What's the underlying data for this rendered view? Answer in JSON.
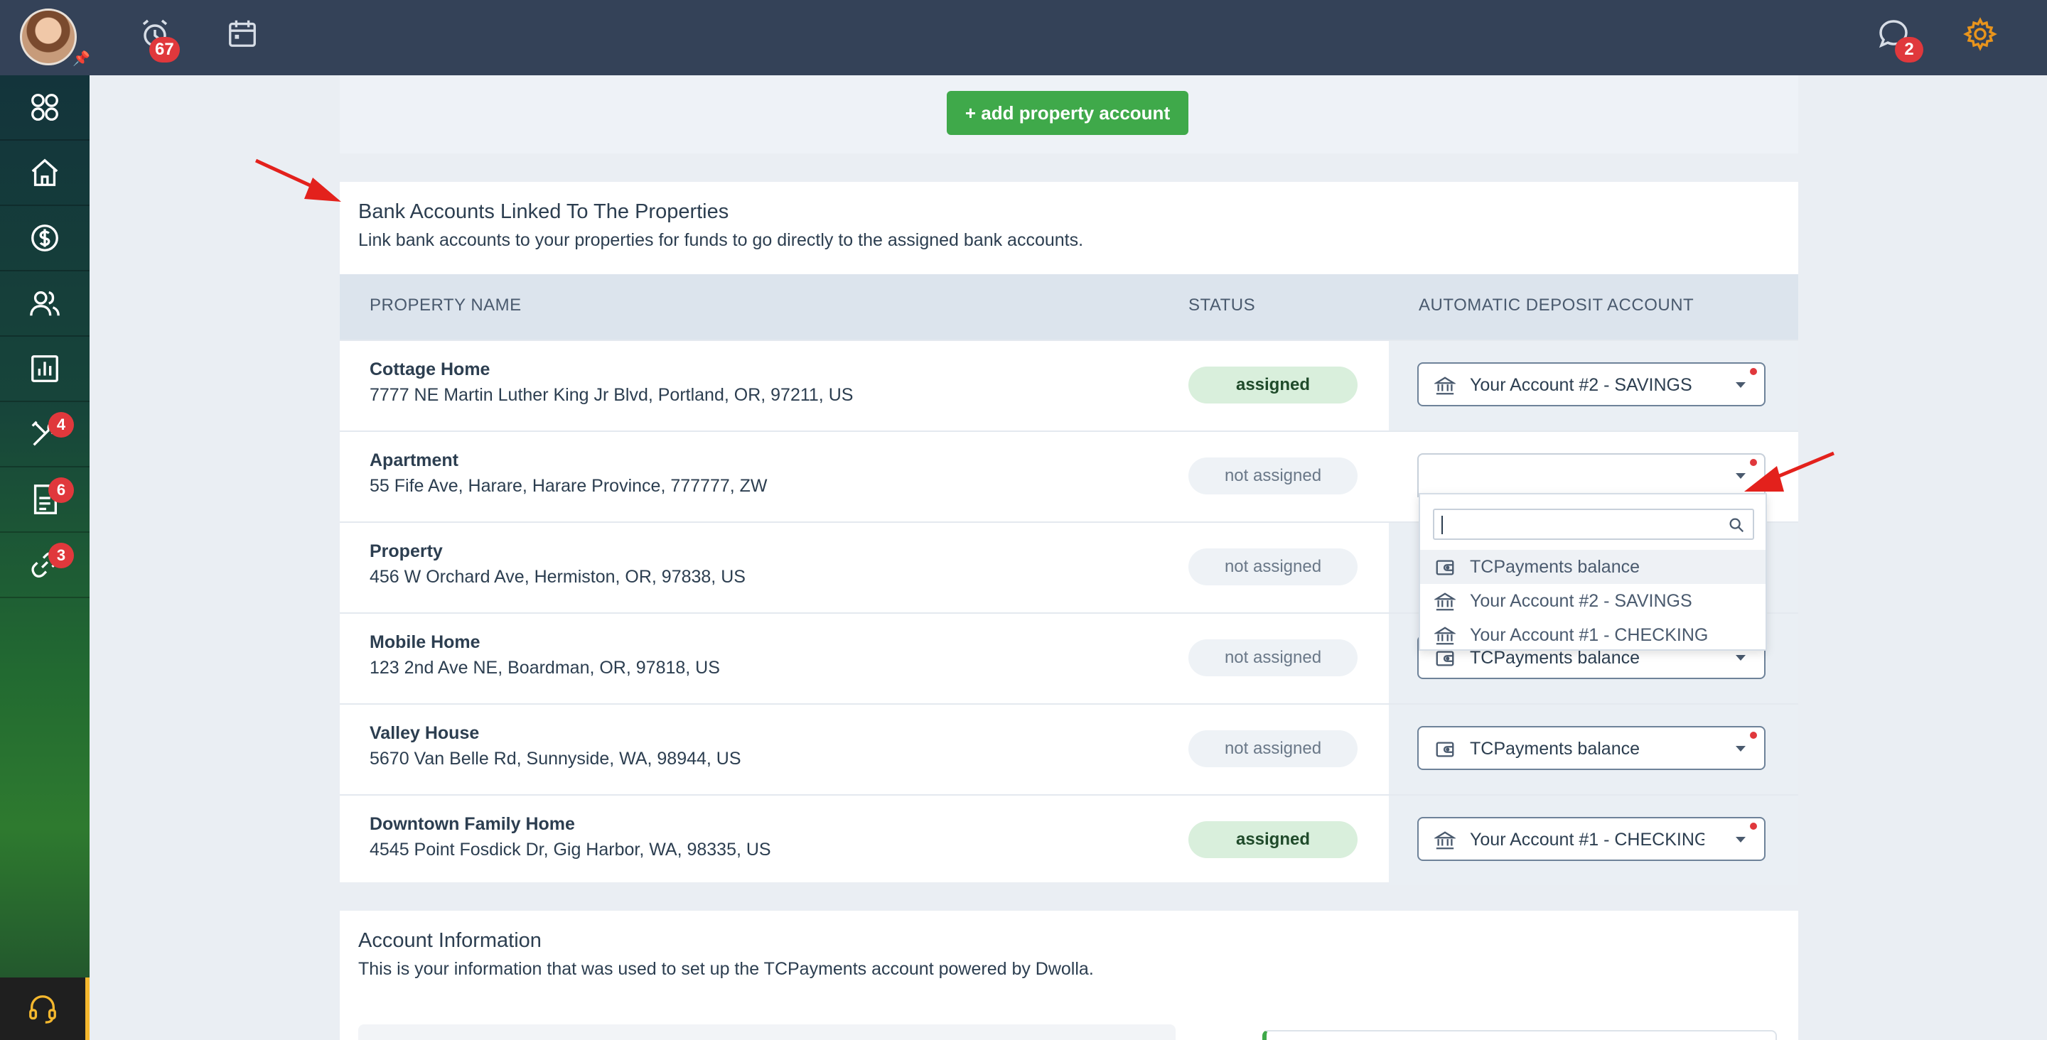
{
  "topbar": {
    "notifications_count": "67",
    "messages_count": "2"
  },
  "sidebar": {
    "items": [
      {
        "name": "dashboard",
        "badge": ""
      },
      {
        "name": "home",
        "badge": ""
      },
      {
        "name": "payments",
        "badge": ""
      },
      {
        "name": "people",
        "badge": ""
      },
      {
        "name": "reports",
        "badge": ""
      },
      {
        "name": "maintenance",
        "badge": "4"
      },
      {
        "name": "documents",
        "badge": "6"
      },
      {
        "name": "links",
        "badge": "3"
      }
    ]
  },
  "top_card": {
    "add_button": "+ add property account"
  },
  "bank_card": {
    "title": "Bank Accounts Linked To The Properties",
    "subtitle": "Link bank accounts to your properties for funds to go directly to the assigned bank accounts.",
    "columns": [
      "PROPERTY NAME",
      "STATUS",
      "AUTOMATIC DEPOSIT ACCOUNT"
    ],
    "rows": [
      {
        "name": "Cottage Home",
        "address": "7777 NE Martin Luther King Jr Blvd, Portland, OR, 97211, US",
        "status": "assigned",
        "account": "Your Account #2 - SAVINGS",
        "account_icon": "bank-icon"
      },
      {
        "name": "Apartment",
        "address": "55 Fife Ave, Harare, Harare Province, 777777, ZW",
        "status": "not assigned",
        "account": "",
        "account_icon": ""
      },
      {
        "name": "Property",
        "address": "456 W Orchard Ave, Hermiston, OR, 97838, US",
        "status": "not assigned",
        "account": "",
        "account_icon": ""
      },
      {
        "name": "Mobile Home",
        "address": "123 2nd Ave NE, Boardman, OR, 97818, US",
        "status": "not assigned",
        "account": "TCPayments balance",
        "account_icon": "wallet-icon"
      },
      {
        "name": "Valley House",
        "address": "5670 Van Belle Rd, Sunnyside, WA, 98944, US",
        "status": "not assigned",
        "account": "TCPayments balance",
        "account_icon": "wallet-icon"
      },
      {
        "name": "Downtown Family Home",
        "address": "4545 Point Fosdick Dr, Gig Harbor, WA, 98335, US",
        "status": "assigned",
        "account": "Your Account #1 - CHECKING",
        "account_icon": "bank-icon"
      }
    ]
  },
  "dropdown": {
    "search_value": "",
    "options": [
      {
        "label": "TCPayments balance",
        "icon": "wallet-icon"
      },
      {
        "label": "Your Account #2 - SAVINGS",
        "icon": "bank-icon"
      },
      {
        "label": "Your Account #1 - CHECKING",
        "icon": "bank-icon"
      }
    ]
  },
  "info_card": {
    "title": "Account Information",
    "subtitle": "This is your information that was used to set up the TCPayments account powered by Dwolla."
  },
  "colors": {
    "topbar": "#344258",
    "accent_green": "#3fa94a",
    "badge_red": "#e0383c",
    "gear_orange": "#e8941c",
    "arrow_red": "#e3211c"
  }
}
